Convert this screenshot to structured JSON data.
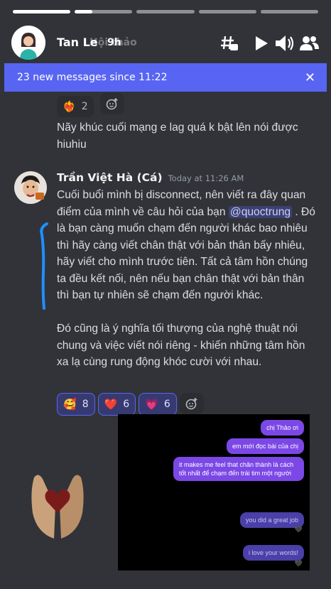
{
  "story": {
    "progress": [
      1.0,
      0.3,
      0,
      0,
      0
    ],
    "poster_name": "Tan Le",
    "time_ago": "9h",
    "ghost_title": "Hội thảo"
  },
  "banner": {
    "text": "23 new messages since 11:22"
  },
  "prev_message": {
    "reaction_count": "2",
    "text": "Nãy khúc cuối mạng e lag quá k bật lên nói được hiuhiu"
  },
  "message": {
    "username": "Trần Việt Hà (Cá)",
    "timestamp": "Today at 11:26 AM",
    "line_before_mention": "Cuối buổi mình bị disconnect, nên viết ra đây quan điểm của mình về câu hỏi của bạn",
    "mention": "@quoctrung",
    "text_after_mention": " . Đó là bạn càng muốn chạm đến người khác bao nhiêu thì hãy càng viết chân thật với bản thân bấy nhiêu, hãy viết cho mình trước tiên. Tất cả tâm hồn chúng ta đều kết nối, nên nếu bạn chân thật với bản thân thì bạn tự nhiên sẽ chạm đến người khác.",
    "paragraph2": "Đó cũng là ý nghĩa tối thượng của nghệ thuật nói chung và việc viết nói riêng - khiến những tâm hồn xa lạ cùng rung động khóc cười với nhau.",
    "reactions": [
      {
        "emoji": "🥰",
        "count": "8"
      },
      {
        "emoji": "❤️",
        "count": "6"
      },
      {
        "emoji": "💗",
        "count": "6"
      }
    ]
  },
  "overlay_chat": {
    "bubbles": [
      {
        "text": "chị Thảo ơi"
      },
      {
        "text": "em mới đọc bài của chị"
      },
      {
        "text": "it makes me feel that chân thành là cách tốt nhất để chạm đến trái tim một người"
      },
      {
        "text": "you did a great job"
      },
      {
        "text": "i love your words!"
      }
    ]
  },
  "colors": {
    "background": "#313338",
    "banner": "#5865f2",
    "bubble_sent": "#7b48e6",
    "blue_annotation": "#1e90ff"
  }
}
